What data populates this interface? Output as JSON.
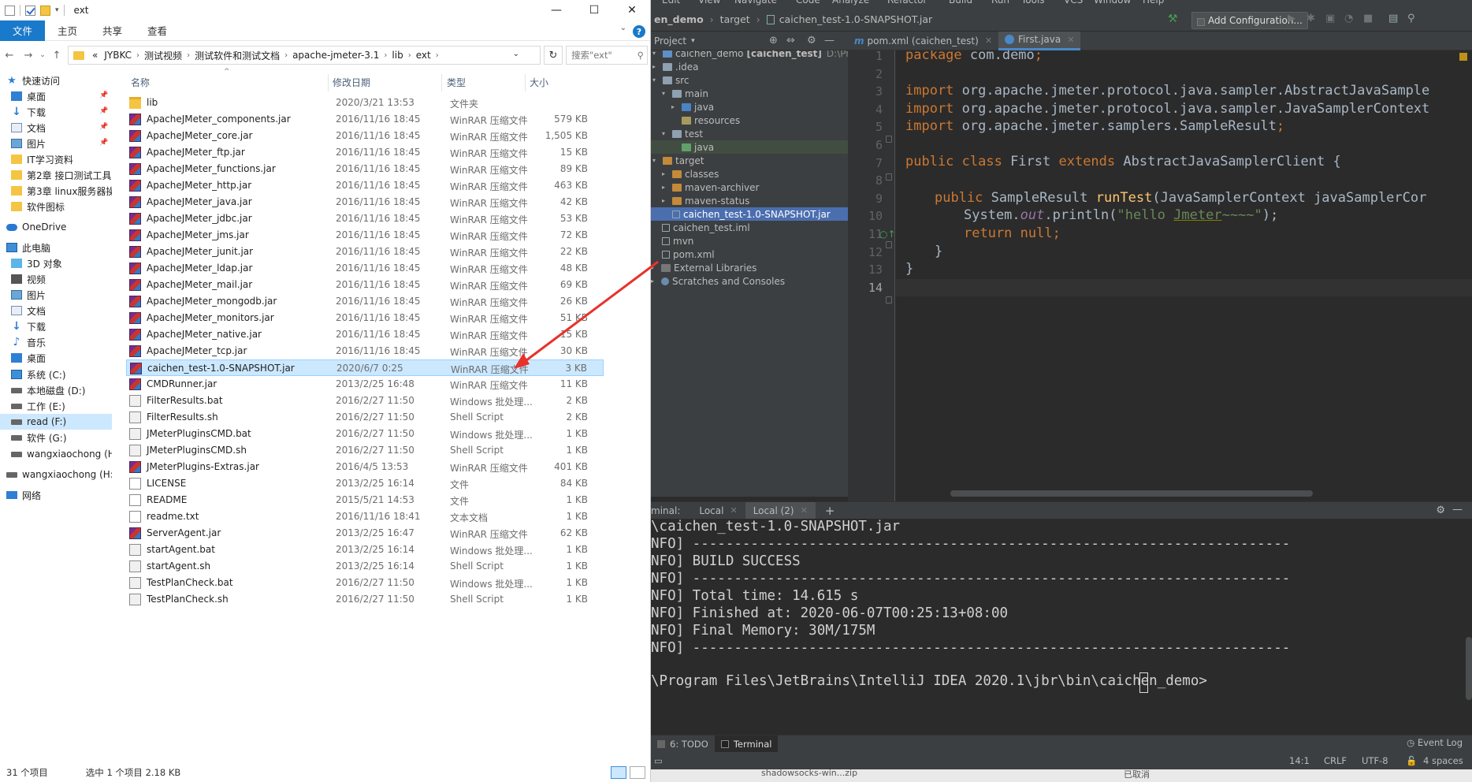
{
  "explorer": {
    "title": "ext",
    "controls": {
      "minimize": "—",
      "maximize": "☐",
      "close": "✕"
    },
    "ribbon_tabs": [
      "文件",
      "主页",
      "共享",
      "查看"
    ],
    "breadcrumb": [
      "JYBKC",
      "测试视频",
      "测试软件和测试文档",
      "apache-jmeter-3.1",
      "lib",
      "ext"
    ],
    "breadcrumb_prefix": "«",
    "search_placeholder": "搜索\"ext\"",
    "nav": {
      "quick_access": "快速访问",
      "desktop1": "桌面",
      "downloads1": "下载",
      "documents1": "文档",
      "pictures1": "图片",
      "it_folder": "IT学习资料",
      "chapter2": "第2章 接口测试工具",
      "chapter3": "第3章 linux服务器操",
      "icons_folder": "软件图标",
      "onedrive": "OneDrive",
      "this_pc": "此电脑",
      "objects3d": "3D 对象",
      "videos": "视频",
      "pictures2": "图片",
      "documents2": "文档",
      "downloads2": "下载",
      "music": "音乐",
      "desktop2": "桌面",
      "drive_c": "系统 (C:)",
      "drive_d": "本地磁盘 (D:)",
      "drive_e": "工作 (E:)",
      "drive_f": "read (F:)",
      "drive_g": "软件 (G:)",
      "user1": "wangxiaochong (H",
      "user2": "wangxiaochong (H:",
      "network": "网络"
    },
    "columns": {
      "name": "名称",
      "date": "修改日期",
      "type": "类型",
      "size": "大小"
    },
    "files": [
      {
        "name": "lib",
        "date": "2020/3/21 13:53",
        "type": "文件夹",
        "size": "",
        "icon": "folder"
      },
      {
        "name": "ApacheJMeter_components.jar",
        "date": "2016/11/16 18:45",
        "type": "WinRAR 压缩文件",
        "size": "579 KB",
        "icon": "jar"
      },
      {
        "name": "ApacheJMeter_core.jar",
        "date": "2016/11/16 18:45",
        "type": "WinRAR 压缩文件",
        "size": "1,505 KB",
        "icon": "jar"
      },
      {
        "name": "ApacheJMeter_ftp.jar",
        "date": "2016/11/16 18:45",
        "type": "WinRAR 压缩文件",
        "size": "15 KB",
        "icon": "jar"
      },
      {
        "name": "ApacheJMeter_functions.jar",
        "date": "2016/11/16 18:45",
        "type": "WinRAR 压缩文件",
        "size": "89 KB",
        "icon": "jar"
      },
      {
        "name": "ApacheJMeter_http.jar",
        "date": "2016/11/16 18:45",
        "type": "WinRAR 压缩文件",
        "size": "463 KB",
        "icon": "jar"
      },
      {
        "name": "ApacheJMeter_java.jar",
        "date": "2016/11/16 18:45",
        "type": "WinRAR 压缩文件",
        "size": "42 KB",
        "icon": "jar"
      },
      {
        "name": "ApacheJMeter_jdbc.jar",
        "date": "2016/11/16 18:45",
        "type": "WinRAR 压缩文件",
        "size": "53 KB",
        "icon": "jar"
      },
      {
        "name": "ApacheJMeter_jms.jar",
        "date": "2016/11/16 18:45",
        "type": "WinRAR 压缩文件",
        "size": "72 KB",
        "icon": "jar"
      },
      {
        "name": "ApacheJMeter_junit.jar",
        "date": "2016/11/16 18:45",
        "type": "WinRAR 压缩文件",
        "size": "22 KB",
        "icon": "jar"
      },
      {
        "name": "ApacheJMeter_ldap.jar",
        "date": "2016/11/16 18:45",
        "type": "WinRAR 压缩文件",
        "size": "48 KB",
        "icon": "jar"
      },
      {
        "name": "ApacheJMeter_mail.jar",
        "date": "2016/11/16 18:45",
        "type": "WinRAR 压缩文件",
        "size": "69 KB",
        "icon": "jar"
      },
      {
        "name": "ApacheJMeter_mongodb.jar",
        "date": "2016/11/16 18:45",
        "type": "WinRAR 压缩文件",
        "size": "26 KB",
        "icon": "jar"
      },
      {
        "name": "ApacheJMeter_monitors.jar",
        "date": "2016/11/16 18:45",
        "type": "WinRAR 压缩文件",
        "size": "51 KB",
        "icon": "jar"
      },
      {
        "name": "ApacheJMeter_native.jar",
        "date": "2016/11/16 18:45",
        "type": "WinRAR 压缩文件",
        "size": "15 KB",
        "icon": "jar"
      },
      {
        "name": "ApacheJMeter_tcp.jar",
        "date": "2016/11/16 18:45",
        "type": "WinRAR 压缩文件",
        "size": "30 KB",
        "icon": "jar"
      },
      {
        "name": "caichen_test-1.0-SNAPSHOT.jar",
        "date": "2020/6/7 0:25",
        "type": "WinRAR 压缩文件",
        "size": "3 KB",
        "icon": "jar",
        "selected": true
      },
      {
        "name": "CMDRunner.jar",
        "date": "2013/2/25 16:48",
        "type": "WinRAR 压缩文件",
        "size": "11 KB",
        "icon": "jar"
      },
      {
        "name": "FilterResults.bat",
        "date": "2016/2/27 11:50",
        "type": "Windows 批处理...",
        "size": "2 KB",
        "icon": "bat"
      },
      {
        "name": "FilterResults.sh",
        "date": "2016/2/27 11:50",
        "type": "Shell Script",
        "size": "2 KB",
        "icon": "bat"
      },
      {
        "name": "JMeterPluginsCMD.bat",
        "date": "2016/2/27 11:50",
        "type": "Windows 批处理...",
        "size": "1 KB",
        "icon": "bat"
      },
      {
        "name": "JMeterPluginsCMD.sh",
        "date": "2016/2/27 11:50",
        "type": "Shell Script",
        "size": "1 KB",
        "icon": "bat"
      },
      {
        "name": "JMeterPlugins-Extras.jar",
        "date": "2016/4/5 13:53",
        "type": "WinRAR 压缩文件",
        "size": "401 KB",
        "icon": "jar"
      },
      {
        "name": "LICENSE",
        "date": "2013/2/25 16:14",
        "type": "文件",
        "size": "84 KB",
        "icon": "txt"
      },
      {
        "name": "README",
        "date": "2015/5/21 14:53",
        "type": "文件",
        "size": "1 KB",
        "icon": "txt"
      },
      {
        "name": "readme.txt",
        "date": "2016/11/16 18:41",
        "type": "文本文档",
        "size": "1 KB",
        "icon": "txt"
      },
      {
        "name": "ServerAgent.jar",
        "date": "2013/2/25 16:47",
        "type": "WinRAR 压缩文件",
        "size": "62 KB",
        "icon": "jar"
      },
      {
        "name": "startAgent.bat",
        "date": "2013/2/25 16:14",
        "type": "Windows 批处理...",
        "size": "1 KB",
        "icon": "bat"
      },
      {
        "name": "startAgent.sh",
        "date": "2013/2/25 16:14",
        "type": "Shell Script",
        "size": "1 KB",
        "icon": "bat"
      },
      {
        "name": "TestPlanCheck.bat",
        "date": "2016/2/27 11:50",
        "type": "Windows 批处理...",
        "size": "1 KB",
        "icon": "bat"
      },
      {
        "name": "TestPlanCheck.sh",
        "date": "2016/2/27 11:50",
        "type": "Shell Script",
        "size": "1 KB",
        "icon": "bat"
      }
    ],
    "status": {
      "count": "31 个项目",
      "selected": "选中 1 个项目  2.18 KB"
    }
  },
  "ide": {
    "menu": [
      "Edit",
      "View",
      "Navigate",
      "Code",
      "Analyze",
      "Refactor",
      "Build",
      "Run",
      "Tools",
      "VCS",
      "Window",
      "Help"
    ],
    "nav_path": {
      "project": "en_demo",
      "folder": "target",
      "file": "caichen_test-1.0-SNAPSHOT.jar"
    },
    "add_config": "Add Configuration...",
    "project_panel": {
      "title": "Project"
    },
    "tree": {
      "root": "caichen_demo",
      "root_module": "[caichen_test]",
      "root_path": "D:\\Progra",
      "idea": ".idea",
      "src": "src",
      "main": "main",
      "java1": "java",
      "resources": "resources",
      "test": "test",
      "java2": "java",
      "target": "target",
      "classes": "classes",
      "maven_archiver": "maven-archiver",
      "maven_status": "maven-status",
      "jar": "caichen_test-1.0-SNAPSHOT.jar",
      "iml": "caichen_test.iml",
      "mvn": "mvn",
      "pom": "pom.xml",
      "external": "External Libraries",
      "scratches": "Scratches and Consoles"
    },
    "tabs": {
      "pom": "pom.xml (caichen_test)",
      "first": "First.java"
    },
    "line_numbers": [
      "1",
      "2",
      "3",
      "4",
      "5",
      "6",
      "7",
      "8",
      "9",
      "10",
      "11",
      "12",
      "13",
      "14"
    ],
    "code": {
      "l1_kw": "package ",
      "l1_rest": "com.demo",
      "l1_semi": ";",
      "l3_kw": "import ",
      "l3_rest": "org.apache.jmeter.protocol.java.sampler.AbstractJavaSample",
      "l4_kw": "import ",
      "l4_rest": "org.apache.jmeter.protocol.java.sampler.JavaSamplerContext",
      "l5_kw": "import ",
      "l5_rest": "org.apache.jmeter.samplers.SampleResult",
      "l5_semi": ";",
      "l7_kw1": "public class ",
      "l7_name": "First ",
      "l7_kw2": "extends ",
      "l7_rest": "AbstractJavaSamplerClient {",
      "l9_kw": "public ",
      "l9_type": "SampleResult ",
      "l9_fn": "runTest",
      "l9_rest": "(JavaSamplerContext javaSamplerCor",
      "l10_pre": "System.",
      "l10_out": "out",
      "l10_mid": ".println(",
      "l10_str1": "\"hello ",
      "l10_str2": "Jmeter",
      "l10_str3": "~~~~\"",
      "l10_end": ");",
      "l11_kw": "return null",
      "l11_semi": ";",
      "l12": "}",
      "l13": "}"
    },
    "terminal": {
      "label": "minal:",
      "tab1": "Local",
      "tab2": "Local (2)",
      "plus": "+",
      "lines": [
        "\\caichen_test-1.0-SNAPSHOT.jar",
        "NFO] ------------------------------------------------------------------------",
        "NFO] BUILD SUCCESS",
        "NFO] ------------------------------------------------------------------------",
        "NFO] Total time: 14.615 s",
        "NFO] Finished at: 2020-06-07T00:25:13+08:00",
        "NFO] Final Memory: 30M/175M",
        "NFO] ------------------------------------------------------------------------",
        "",
        "\\Program Files\\JetBrains\\IntelliJ IDEA 2020.1\\jbr\\bin\\caichen_demo>"
      ]
    },
    "toolwindows": {
      "todo": "6: TODO",
      "terminal": "Terminal",
      "event_log": "Event Log"
    },
    "status": {
      "pos": "14:1",
      "eol": "CRLF",
      "enc": "UTF-8",
      "indent": "4 spaces"
    }
  },
  "taskbar": {
    "item1": "shadowsocks-win...zip",
    "item2": "已取消"
  },
  "colors": {
    "accent": "#1979ca",
    "arrow": "#e8322b",
    "ide_bg": "#2b2b2b"
  }
}
